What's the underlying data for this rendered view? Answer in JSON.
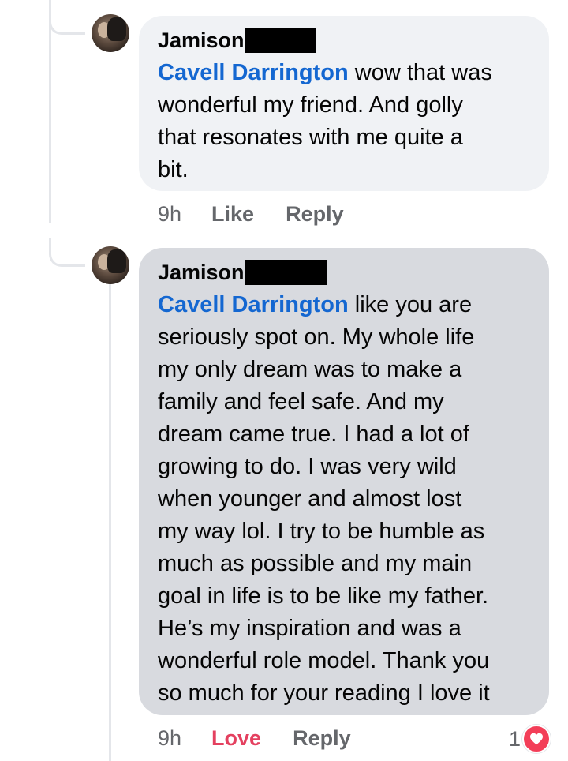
{
  "comments": [
    {
      "author": "Jamison",
      "mention": "Cavell Darrington",
      "text": " wow that was\nwonderful my friend. And golly\nthat resonates with me quite a\nbit.",
      "time": "9h",
      "action_1": "Like",
      "action_2": "Reply"
    },
    {
      "author": "Jamison",
      "mention": "Cavell Darrington",
      "text": " like you are\nseriously spot on. My whole life\nmy only dream was to make a\nfamily and feel safe. And my\ndream came true. I had a lot of\ngrowing to do. I was very wild\nwhen younger and almost lost\nmy way lol. I try to be humble as\nmuch as possible and my main\ngoal in life is to be like my father.\nHe’s my inspiration and was a\nwonderful role model. Thank you\nso much for your reading I love it",
      "time": "9h",
      "action_1": "Love",
      "action_2": "Reply",
      "reaction_count": "1",
      "reaction_icon": "heart-icon"
    }
  ],
  "colors": {
    "mention": "#1467d1",
    "love": "#e4405f",
    "heart": "#f33e58",
    "bubble_1": "#f0f2f5",
    "bubble_2": "#d8dadf"
  }
}
